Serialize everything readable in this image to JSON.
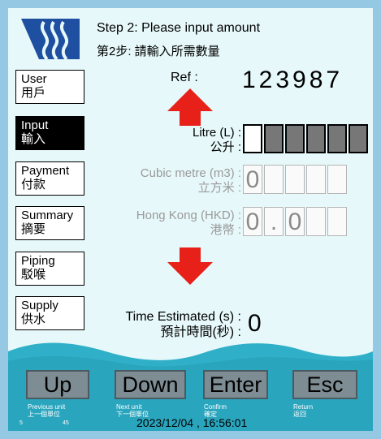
{
  "header": {
    "logo_icon": "water-supplies-logo-icon",
    "step_en": "Step 2: Please input amount",
    "step_zh": "第2步: 請輸入所需數量"
  },
  "sidebar": {
    "items": [
      {
        "en": "User",
        "zh": "用戶",
        "active": false
      },
      {
        "en": "Input",
        "zh": "輸入",
        "active": true
      },
      {
        "en": "Payment",
        "zh": "付款",
        "active": false
      },
      {
        "en": "Summary",
        "zh": "摘要",
        "active": false
      },
      {
        "en": "Piping",
        "zh": "駁喉",
        "active": false
      },
      {
        "en": "Supply",
        "zh": "供水",
        "active": false
      }
    ]
  },
  "ref": {
    "label": "Ref :",
    "value": "123987"
  },
  "fields": {
    "litre": {
      "label_en": "Litre (L) :",
      "label_zh": "公升 :",
      "digits": [
        "",
        "",
        "",
        "",
        "",
        ""
      ]
    },
    "cubic": {
      "label_en": "Cubic metre (m3) :",
      "label_zh": "立方米 :",
      "digits": [
        "0",
        "",
        "",
        "",
        ""
      ]
    },
    "hkd": {
      "label_en": "Hong Kong (HKD) :",
      "label_zh": "港幣 :",
      "digits": [
        "0",
        ".",
        "0",
        "",
        ""
      ]
    }
  },
  "time": {
    "label_en": "Time Estimated (s) :",
    "label_zh": "預計時間(秒) :",
    "value": "0"
  },
  "indicators": {
    "up_arrow_icon": "red-up-arrow-icon",
    "down_arrow_icon": "red-down-arrow-icon",
    "color": "#e8201a"
  },
  "keys": {
    "up": {
      "label": "Up",
      "hint_en": "Previous unit",
      "hint_zh": "上一個單位"
    },
    "down": {
      "label": "Down",
      "hint_en": "Next unit",
      "hint_zh": "下一個單位"
    },
    "enter": {
      "label": "Enter",
      "hint_en": "Confirm",
      "hint_zh": "確定"
    },
    "esc": {
      "label": "Esc",
      "hint_en": "Return",
      "hint_zh": "返回"
    }
  },
  "status": {
    "left": "5",
    "mid": "45",
    "datetime": "2023/12/04 , 16:56:01"
  },
  "colors": {
    "background": "#e6f8fa",
    "frame": "#95c9e3",
    "wave": "#2fb0c8",
    "logo": "#1e4fa0"
  }
}
